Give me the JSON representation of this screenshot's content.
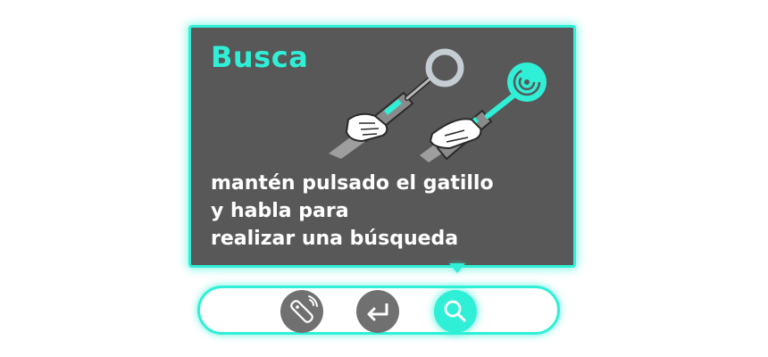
{
  "tooltip": {
    "title": "Busca",
    "body_lines": [
      "mantén pulsado el gatillo",
      "y habla para",
      "realizar una búsqueda"
    ],
    "illustration_icons": [
      "hand-holding-remote-icon",
      "magnifier-icon",
      "voice-search-icon"
    ]
  },
  "nav": {
    "buttons": [
      {
        "icon": "remote-pointer-icon",
        "active": false
      },
      {
        "icon": "enter-return-icon",
        "active": false
      },
      {
        "icon": "search-icon",
        "active": true
      }
    ]
  },
  "colors": {
    "accent": "#2ff0d6",
    "card_background": "#585858",
    "button_inactive": "#707070",
    "text_light": "#ffffff"
  }
}
